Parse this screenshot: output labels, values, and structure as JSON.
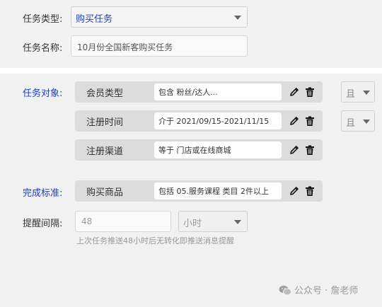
{
  "task_type": {
    "label": "任务类型:",
    "value": "购买任务"
  },
  "task_name": {
    "label": "任务名称:",
    "value": "10月份全国新客购买任务"
  },
  "task_object": {
    "label": "任务对象:",
    "conditions": [
      {
        "name": "会员类型",
        "value": "包含 粉丝/达人...",
        "logic": "且"
      },
      {
        "name": "注册时间",
        "value": "介于 2021/09/15-2021/11/15",
        "logic": "且"
      },
      {
        "name": "注册渠道",
        "value": "等于 门店或在线商城"
      }
    ]
  },
  "completion": {
    "label": "完成标准:",
    "conditions": [
      {
        "name": "购买商品",
        "value": "包括 05.服务课程 类目 2件以上"
      }
    ]
  },
  "reminder": {
    "label": "提醒间隔:",
    "value": "48",
    "unit": "小时",
    "hint": "上次任务推送48小时后无转化即推送消息提醒"
  },
  "watermark": {
    "text": "公众号 · 詹老师"
  },
  "colors": {
    "accent_blue": "#1f3fbf",
    "panel_bg": "#f2f2f2",
    "condition_bg": "#dcdcdc"
  },
  "icons": [
    "pencil-icon",
    "trash-icon",
    "chevron-down-icon",
    "wechat-icon"
  ]
}
